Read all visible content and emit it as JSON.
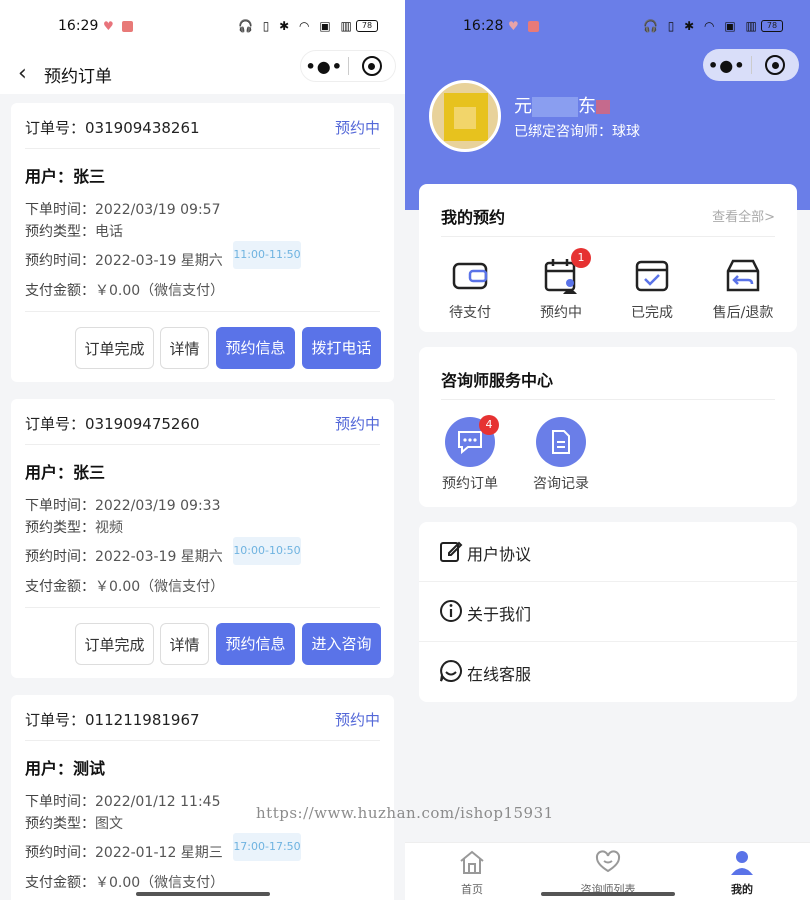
{
  "left": {
    "status_time": "16:29",
    "battery": "78",
    "nav_title": "预约订单",
    "labels": {
      "order_no": "订单号：",
      "user": "用户：",
      "created": "下单时间：",
      "type": "预约类型：",
      "appt": "预约时间：",
      "pay": "支付金额："
    },
    "orders": [
      {
        "no": "031909438261",
        "status": "预约中",
        "user": "张三",
        "created": "2022/03/19 09:57",
        "type": "电话",
        "appt": "2022-03-19 星期六",
        "slot": "11:00-11:50",
        "pay": "￥0.00（微信支付）",
        "buttons": [
          "订单完成",
          "详情",
          "预约信息",
          "拨打电话"
        ]
      },
      {
        "no": "031909475260",
        "status": "预约中",
        "user": "张三",
        "created": "2022/03/19 09:33",
        "type": "视频",
        "appt": "2022-03-19 星期六",
        "slot": "10:00-10:50",
        "pay": "￥0.00（微信支付）",
        "buttons": [
          "订单完成",
          "详情",
          "预约信息",
          "进入咨询"
        ]
      },
      {
        "no": "011211981967",
        "status": "预约中",
        "user": "测试",
        "created": "2022/01/12 11:45",
        "type": "图文",
        "appt": "2022-01-12 星期三",
        "slot": "17:00-17:50",
        "pay": "￥0.00（微信支付）"
      }
    ]
  },
  "right": {
    "status_time": "16:28",
    "battery": "78",
    "user_name_visible_start": "元",
    "user_name_visible_mid": "东",
    "bound_text": "已绑定咨询师：球球",
    "my_appt": {
      "title": "我的预约",
      "view_all": "查看全部>",
      "items": [
        {
          "label": "待支付",
          "icon": "wallet-icon"
        },
        {
          "label": "预约中",
          "icon": "calendar-user-icon",
          "badge": "1"
        },
        {
          "label": "已完成",
          "icon": "calendar-check-icon"
        },
        {
          "label": "售后/退款",
          "icon": "refund-box-icon"
        }
      ]
    },
    "service": {
      "title": "咨询师服务中心",
      "items": [
        {
          "label": "预约订单",
          "icon": "chat-icon",
          "badge": "4"
        },
        {
          "label": "咨询记录",
          "icon": "document-icon"
        }
      ]
    },
    "menu": [
      {
        "label": "用户协议",
        "icon": "edit-icon"
      },
      {
        "label": "关于我们",
        "icon": "info-icon"
      },
      {
        "label": "在线客服",
        "icon": "support-chat-icon"
      }
    ],
    "tabs": [
      {
        "label": "首页",
        "icon": "home-icon"
      },
      {
        "label": "咨询师列表",
        "icon": "heart-chat-icon"
      },
      {
        "label": "我的",
        "icon": "person-icon"
      }
    ]
  },
  "watermark": "https://www.huzhan.com/ishop15931",
  "colors": {
    "accent": "#5a73e8",
    "hero": "#6a7ee8",
    "status_text": "#5468d8",
    "badge": "#e63232"
  }
}
